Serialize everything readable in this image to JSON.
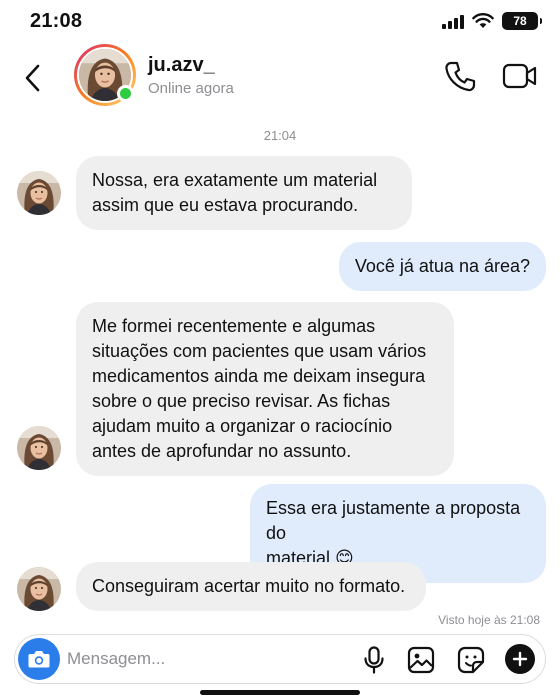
{
  "status_bar": {
    "time": "21:08",
    "battery": "78"
  },
  "contact": {
    "username": "ju.azv_",
    "status": "Online agora"
  },
  "conversation": {
    "timestamp": "21:04",
    "messages": [
      {
        "from": "them",
        "lines": [
          "Nossa, era exatamente um material",
          "assim que eu estava procurando."
        ]
      },
      {
        "from": "me",
        "lines": [
          "Você já atua na área?"
        ]
      },
      {
        "from": "them",
        "lines": [
          "Me formei recentemente e algumas",
          "situações com pacientes que usam vários",
          "medicamentos ainda me deixam insegura",
          "sobre o que preciso revisar. As fichas",
          "ajudam muito a organizar o raciocínio",
          "antes de aprofundar no assunto."
        ]
      },
      {
        "from": "me",
        "lines": [
          "Essa era justamente a proposta do",
          "material 😊"
        ]
      },
      {
        "from": "them",
        "lines": [
          "Conseguiram acertar muito no formato."
        ]
      }
    ],
    "seen": "Visto hoje às 21:08"
  },
  "composer": {
    "placeholder": "Mensagem..."
  },
  "colors": {
    "accent": "#2b7de9",
    "online": "#2ecc40",
    "incoming_bubble": "#efefef",
    "outgoing_bubble": "#e0ecfc"
  },
  "icons": [
    "back-icon",
    "phone-icon",
    "video-icon",
    "camera-icon",
    "mic-icon",
    "image-icon",
    "sticker-icon",
    "plus-icon"
  ]
}
